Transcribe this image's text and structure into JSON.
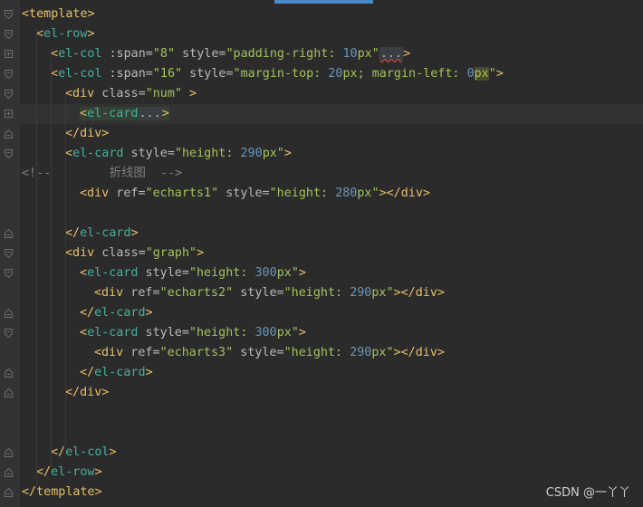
{
  "editor": {
    "lines": [
      {
        "indent": 0,
        "fold": "open",
        "tokens": [
          [
            "tag",
            "<template>"
          ]
        ]
      },
      {
        "indent": 1,
        "fold": "line",
        "tokens": [
          [
            "tag",
            "<"
          ],
          [
            "elc",
            "el-row"
          ],
          [
            "tag",
            ">"
          ]
        ]
      },
      {
        "indent": 2,
        "fold": "plus",
        "tokens": [
          [
            "tag",
            "<"
          ],
          [
            "elc",
            "el-col"
          ],
          [
            "attr",
            " :span="
          ],
          [
            "str",
            "\"8\""
          ],
          [
            "attr",
            " style="
          ],
          [
            "str",
            "\"padding-right: "
          ],
          [
            "num",
            "10"
          ],
          [
            "str",
            "px\""
          ],
          [
            "fold-mark squiggle",
            "..."
          ],
          [
            "tag",
            ">"
          ]
        ]
      },
      {
        "indent": 2,
        "fold": "open",
        "tokens": [
          [
            "tag",
            "<"
          ],
          [
            "elc",
            "el-col"
          ],
          [
            "attr",
            " :span="
          ],
          [
            "str",
            "\"16\""
          ],
          [
            "attr",
            " style="
          ],
          [
            "str",
            "\"margin-top: "
          ],
          [
            "num",
            "20"
          ],
          [
            "str",
            "px; margin-left: "
          ],
          [
            "num",
            "0"
          ],
          [
            "str px-hl",
            "px"
          ],
          [
            "str",
            "\""
          ],
          [
            "tag",
            ">"
          ]
        ]
      },
      {
        "indent": 3,
        "fold": "open",
        "tokens": [
          [
            "tag",
            "<div"
          ],
          [
            "attr",
            " class="
          ],
          [
            "str",
            "\"num\""
          ],
          [
            "tag",
            " >"
          ]
        ]
      },
      {
        "indent": 4,
        "fold": "plus",
        "current": true,
        "tokens": [
          [
            "tag hl-green",
            "<"
          ],
          [
            "elc hl-green",
            "el-card"
          ],
          [
            "fold-mark",
            "..."
          ],
          [
            "tag hl-green",
            ">"
          ]
        ]
      },
      {
        "indent": 3,
        "fold": "close",
        "tokens": [
          [
            "tag",
            "</div>"
          ]
        ]
      },
      {
        "indent": 3,
        "fold": "open",
        "tokens": [
          [
            "tag",
            "<"
          ],
          [
            "elc",
            "el-card"
          ],
          [
            "attr",
            " style="
          ],
          [
            "str",
            "\"height: "
          ],
          [
            "num",
            "290"
          ],
          [
            "str",
            "px\""
          ],
          [
            "tag",
            ">"
          ]
        ]
      },
      {
        "indent": 0,
        "fold": "none",
        "tokens": [
          [
            "cmt",
            "<!--        折线图  -->"
          ]
        ]
      },
      {
        "indent": 4,
        "fold": "none",
        "tokens": [
          [
            "tag",
            "<div"
          ],
          [
            "attr",
            " ref="
          ],
          [
            "str",
            "\"echarts1\""
          ],
          [
            "attr",
            " style="
          ],
          [
            "str",
            "\"height: "
          ],
          [
            "num",
            "280"
          ],
          [
            "str",
            "px\""
          ],
          [
            "tag",
            "></div>"
          ]
        ]
      },
      {
        "indent": 0,
        "fold": "none",
        "tokens": []
      },
      {
        "indent": 3,
        "fold": "close",
        "tokens": [
          [
            "tag",
            "</"
          ],
          [
            "elc",
            "el-card"
          ],
          [
            "tag",
            ">"
          ]
        ]
      },
      {
        "indent": 3,
        "fold": "open",
        "tokens": [
          [
            "tag",
            "<div"
          ],
          [
            "attr",
            " class="
          ],
          [
            "str",
            "\"graph\""
          ],
          [
            "tag",
            ">"
          ]
        ]
      },
      {
        "indent": 4,
        "fold": "open",
        "tokens": [
          [
            "tag",
            "<"
          ],
          [
            "elc",
            "el-card"
          ],
          [
            "attr",
            " style="
          ],
          [
            "str",
            "\"height: "
          ],
          [
            "num",
            "300"
          ],
          [
            "str",
            "px\""
          ],
          [
            "tag",
            ">"
          ]
        ]
      },
      {
        "indent": 5,
        "fold": "none",
        "tokens": [
          [
            "tag",
            "<div"
          ],
          [
            "attr",
            " ref="
          ],
          [
            "str",
            "\"echarts2\""
          ],
          [
            "attr",
            " style="
          ],
          [
            "str",
            "\"height: "
          ],
          [
            "num",
            "290"
          ],
          [
            "str",
            "px\""
          ],
          [
            "tag",
            "></div>"
          ]
        ]
      },
      {
        "indent": 4,
        "fold": "close",
        "tokens": [
          [
            "tag",
            "</"
          ],
          [
            "elc",
            "el-card"
          ],
          [
            "tag",
            ">"
          ]
        ]
      },
      {
        "indent": 4,
        "fold": "open",
        "tokens": [
          [
            "tag",
            "<"
          ],
          [
            "elc",
            "el-card"
          ],
          [
            "attr",
            " style="
          ],
          [
            "str",
            "\"height: "
          ],
          [
            "num",
            "300"
          ],
          [
            "str",
            "px\""
          ],
          [
            "tag",
            ">"
          ]
        ]
      },
      {
        "indent": 5,
        "fold": "none",
        "tokens": [
          [
            "tag",
            "<div"
          ],
          [
            "attr",
            " ref="
          ],
          [
            "str",
            "\"echarts3\""
          ],
          [
            "attr",
            " style="
          ],
          [
            "str",
            "\"height: "
          ],
          [
            "num",
            "290"
          ],
          [
            "str",
            "px\""
          ],
          [
            "tag",
            "></div>"
          ]
        ]
      },
      {
        "indent": 4,
        "fold": "close",
        "tokens": [
          [
            "tag",
            "</"
          ],
          [
            "elc",
            "el-card"
          ],
          [
            "tag",
            ">"
          ]
        ]
      },
      {
        "indent": 3,
        "fold": "close",
        "tokens": [
          [
            "tag",
            "</div>"
          ]
        ]
      },
      {
        "indent": 0,
        "fold": "none",
        "tokens": []
      },
      {
        "indent": 0,
        "fold": "none",
        "tokens": []
      },
      {
        "indent": 2,
        "fold": "close",
        "tokens": [
          [
            "tag",
            "</"
          ],
          [
            "elc",
            "el-col"
          ],
          [
            "tag",
            ">"
          ]
        ]
      },
      {
        "indent": 1,
        "fold": "close",
        "tokens": [
          [
            "tag",
            "</"
          ],
          [
            "elc",
            "el-row"
          ],
          [
            "tag",
            ">"
          ]
        ]
      },
      {
        "indent": 0,
        "fold": "close",
        "tokens": [
          [
            "tag",
            "</template>"
          ]
        ]
      }
    ]
  },
  "watermark": "CSDN @一丫丫",
  "colors": {
    "background": "#2b2b2b",
    "tag": "#e8bf6a",
    "component": "#48b0a0",
    "string": "#a5c25c",
    "number": "#6897bb",
    "comment": "#808080"
  }
}
